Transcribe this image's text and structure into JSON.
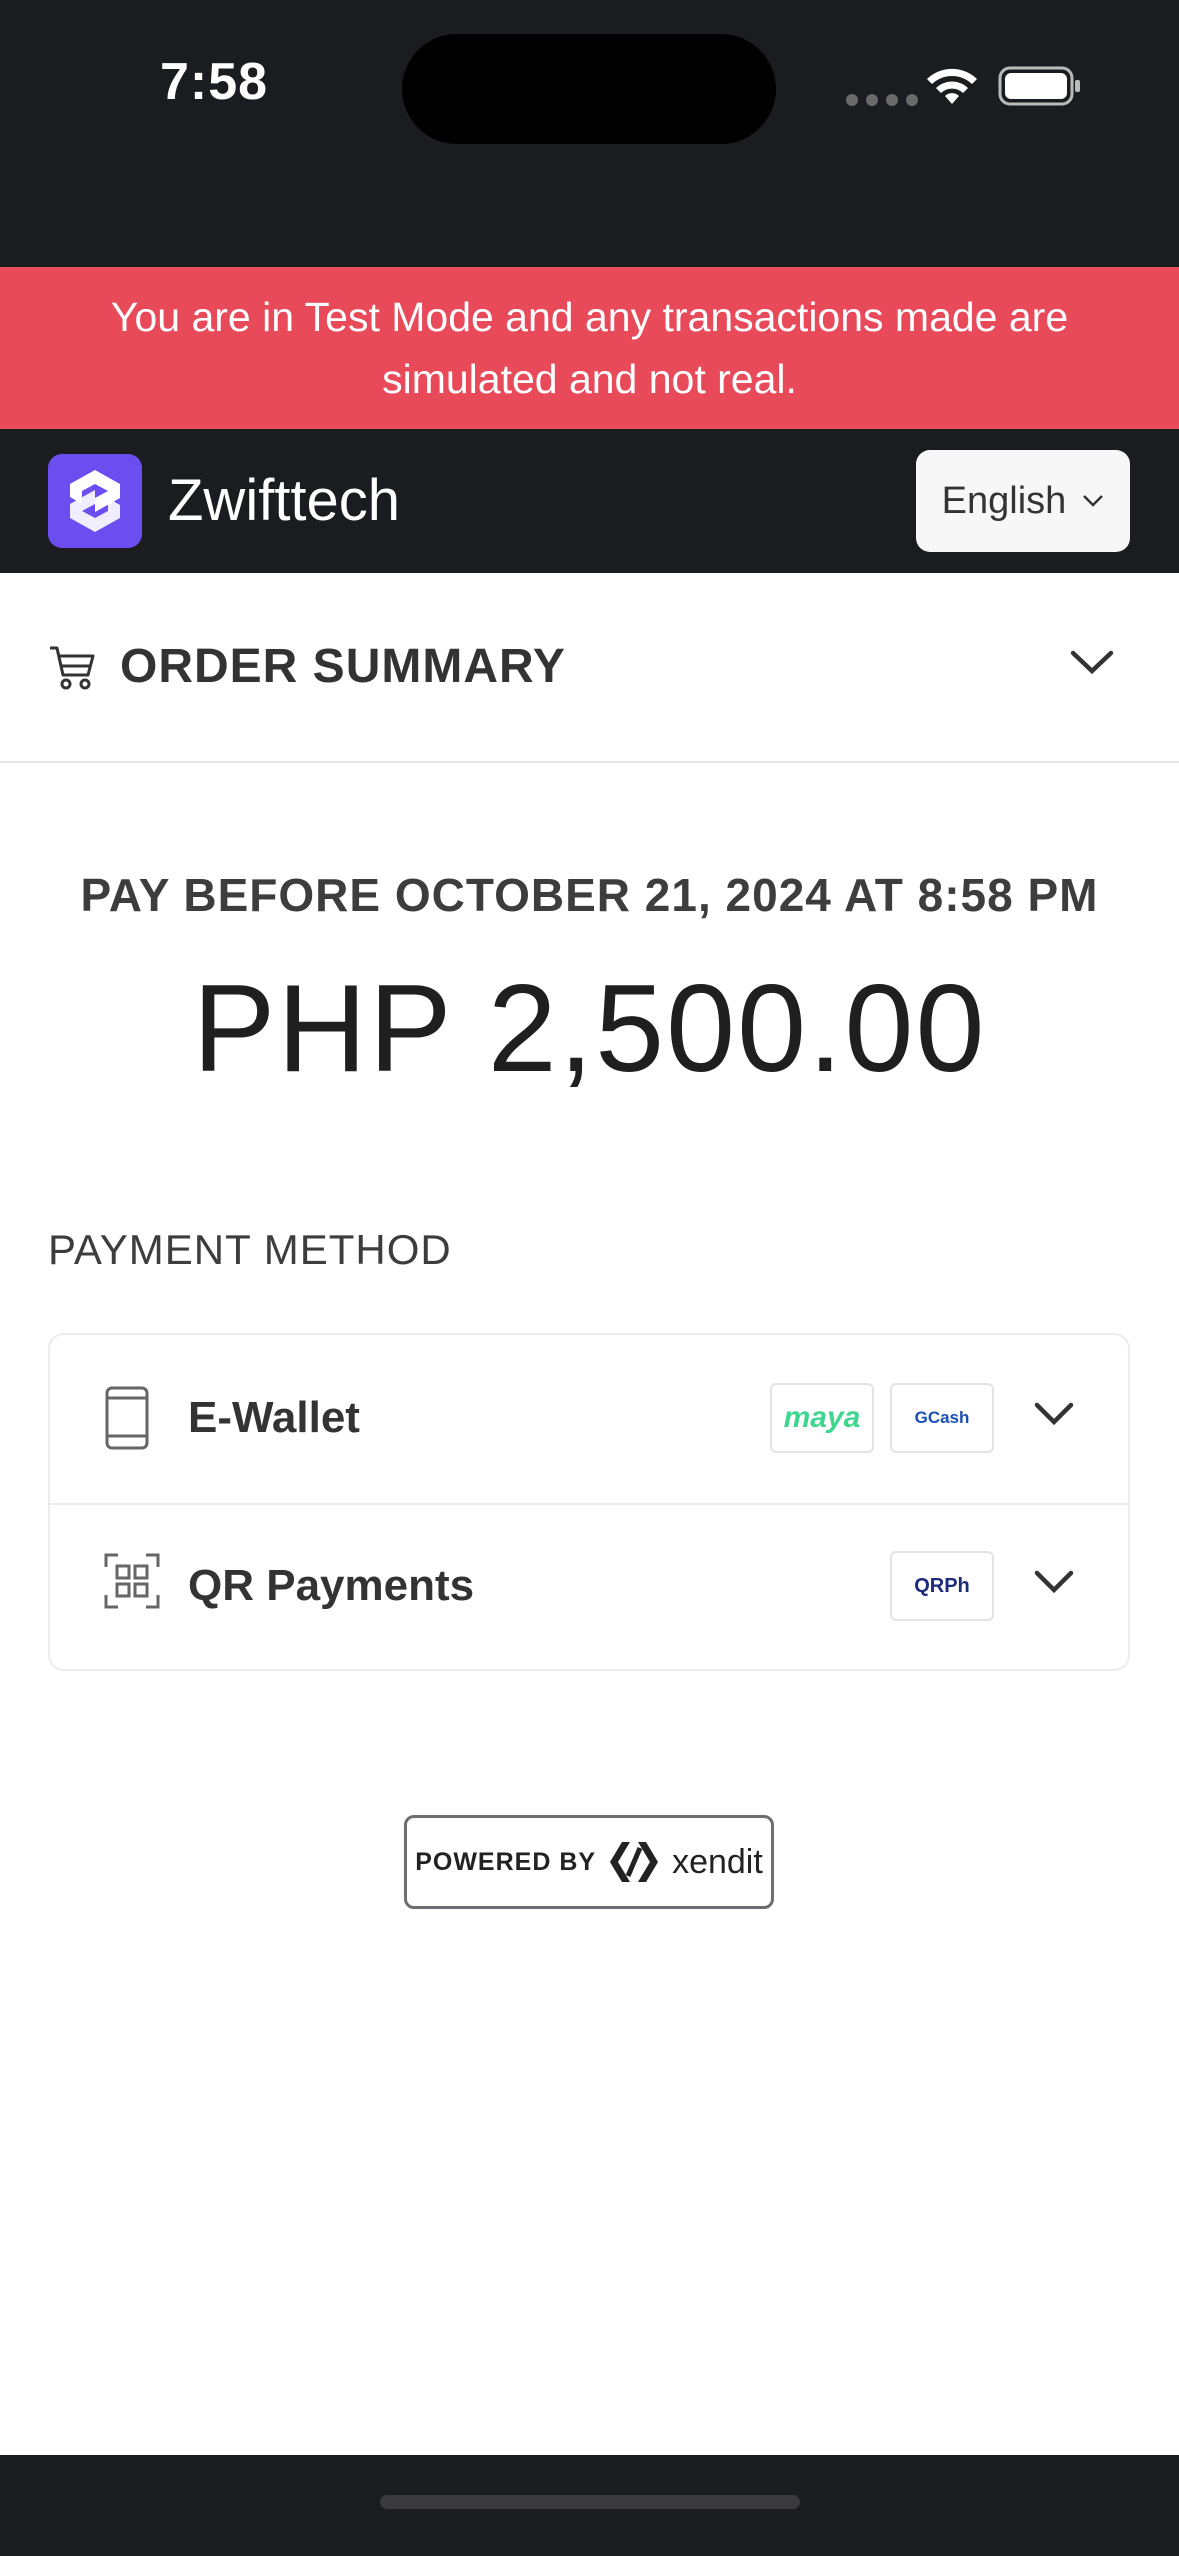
{
  "status_bar": {
    "time": "7:58"
  },
  "banner": {
    "text": "You are in Test Mode and any transactions made are simulated and not real."
  },
  "merchant": {
    "name": "Zwifttech"
  },
  "language": {
    "selected": "English"
  },
  "order_summary": {
    "title": "ORDER SUMMARY"
  },
  "payment": {
    "deadline": "PAY BEFORE OCTOBER 21, 2024 AT 8:58 PM",
    "amount": "PHP 2,500.00"
  },
  "payment_methods": {
    "heading": "PAYMENT METHOD",
    "items": [
      {
        "label": "E-Wallet",
        "icon": "phone-icon",
        "brands": [
          "maya",
          "GCash"
        ]
      },
      {
        "label": "QR Payments",
        "icon": "qr-scan-icon",
        "brands": [
          "QRPh"
        ]
      }
    ]
  },
  "footer": {
    "powered_by": "POWERED BY",
    "provider": "xendit"
  },
  "colors": {
    "banner": "#e84a5a",
    "header_bg": "#1b1c1f",
    "logo": "#6c4df0"
  }
}
